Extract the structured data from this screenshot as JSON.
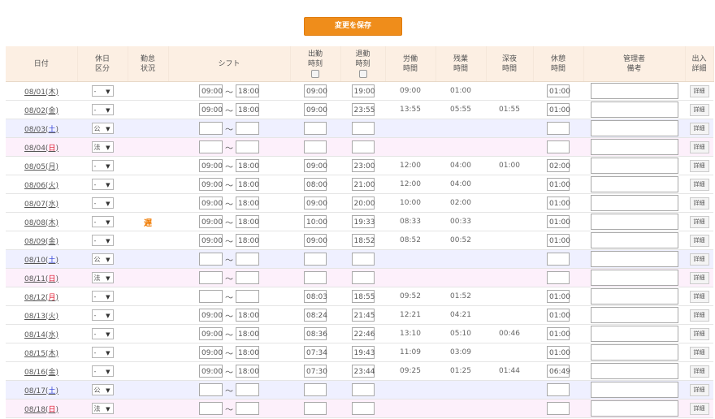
{
  "save_button": "変更を保存",
  "headers": {
    "date": "日付",
    "holiday1": "休日",
    "holiday2": "区分",
    "status1": "勤怠",
    "status2": "状況",
    "shift": "シフト",
    "in1": "出勤",
    "in2": "時刻",
    "out1": "退勤",
    "out2": "時刻",
    "work1": "労働",
    "work2": "時間",
    "over1": "残業",
    "over2": "時間",
    "night1": "深夜",
    "night2": "時間",
    "break1": "休憩",
    "break2": "時間",
    "memo1": "管理者",
    "memo2": "備考",
    "io1": "出入",
    "io2": "詳細"
  },
  "tilde": "～",
  "detail_label": "詳細",
  "rows": [
    {
      "date": "08/01(",
      "wd": "木",
      "wd_type": "weekday",
      "kubun": "-",
      "status": "",
      "shift_start": "09:00",
      "shift_end": "18:00",
      "in": "09:00",
      "out": "19:00",
      "work": "09:00",
      "over": "01:00",
      "night": "",
      "break": "01:00"
    },
    {
      "date": "08/02(",
      "wd": "金",
      "wd_type": "weekday",
      "kubun": "-",
      "status": "",
      "shift_start": "09:00",
      "shift_end": "18:00",
      "in": "09:00",
      "out": "23:55",
      "work": "13:55",
      "over": "05:55",
      "night": "01:55",
      "break": "01:00"
    },
    {
      "date": "08/03(",
      "wd": "土",
      "wd_type": "sat",
      "kubun": "公",
      "status": "",
      "shift_start": "",
      "shift_end": "",
      "in": "",
      "out": "",
      "work": "",
      "over": "",
      "night": "",
      "break": ""
    },
    {
      "date": "08/04(",
      "wd": "日",
      "wd_type": "sun",
      "kubun": "法",
      "status": "",
      "shift_start": "",
      "shift_end": "",
      "in": "",
      "out": "",
      "work": "",
      "over": "",
      "night": "",
      "break": ""
    },
    {
      "date": "08/05(",
      "wd": "月",
      "wd_type": "weekday",
      "kubun": "-",
      "status": "",
      "shift_start": "09:00",
      "shift_end": "18:00",
      "in": "09:00",
      "out": "23:00",
      "work": "12:00",
      "over": "04:00",
      "night": "01:00",
      "break": "02:00"
    },
    {
      "date": "08/06(",
      "wd": "火",
      "wd_type": "weekday",
      "kubun": "-",
      "status": "",
      "shift_start": "09:00",
      "shift_end": "18:00",
      "in": "08:00",
      "out": "21:00",
      "work": "12:00",
      "over": "04:00",
      "night": "",
      "break": "01:00"
    },
    {
      "date": "08/07(",
      "wd": "水",
      "wd_type": "weekday",
      "kubun": "-",
      "status": "",
      "shift_start": "09:00",
      "shift_end": "18:00",
      "in": "09:00",
      "out": "20:00",
      "work": "10:00",
      "over": "02:00",
      "night": "",
      "break": "01:00"
    },
    {
      "date": "08/08(",
      "wd": "木",
      "wd_type": "weekday",
      "kubun": "-",
      "status": "遅",
      "shift_start": "09:00",
      "shift_end": "18:00",
      "in": "10:00",
      "out": "19:33",
      "work": "08:33",
      "over": "00:33",
      "night": "",
      "break": "01:00"
    },
    {
      "date": "08/09(",
      "wd": "金",
      "wd_type": "weekday",
      "kubun": "-",
      "status": "",
      "shift_start": "09:00",
      "shift_end": "18:00",
      "in": "09:00",
      "out": "18:52",
      "work": "08:52",
      "over": "00:52",
      "night": "",
      "break": "01:00"
    },
    {
      "date": "08/10(",
      "wd": "土",
      "wd_type": "sat",
      "kubun": "公",
      "status": "",
      "shift_start": "",
      "shift_end": "",
      "in": "",
      "out": "",
      "work": "",
      "over": "",
      "night": "",
      "break": ""
    },
    {
      "date": "08/11(",
      "wd": "日",
      "wd_type": "sun",
      "kubun": "法",
      "status": "",
      "shift_start": "",
      "shift_end": "",
      "in": "",
      "out": "",
      "work": "",
      "over": "",
      "night": "",
      "break": ""
    },
    {
      "date": "08/12(",
      "wd": "月",
      "wd_type": "holiday",
      "kubun": "-",
      "status": "",
      "shift_start": "",
      "shift_end": "",
      "in": "08:03",
      "out": "18:55",
      "work": "09:52",
      "over": "01:52",
      "night": "",
      "break": "01:00"
    },
    {
      "date": "08/13(",
      "wd": "火",
      "wd_type": "weekday",
      "kubun": "-",
      "status": "",
      "shift_start": "09:00",
      "shift_end": "18:00",
      "in": "08:24",
      "out": "21:45",
      "work": "12:21",
      "over": "04:21",
      "night": "",
      "break": "01:00"
    },
    {
      "date": "08/14(",
      "wd": "水",
      "wd_type": "weekday",
      "kubun": "-",
      "status": "",
      "shift_start": "09:00",
      "shift_end": "18:00",
      "in": "08:36",
      "out": "22:46",
      "work": "13:10",
      "over": "05:10",
      "night": "00:46",
      "break": "01:00"
    },
    {
      "date": "08/15(",
      "wd": "木",
      "wd_type": "weekday",
      "kubun": "-",
      "status": "",
      "shift_start": "09:00",
      "shift_end": "18:00",
      "in": "07:34",
      "out": "19:43",
      "work": "11:09",
      "over": "03:09",
      "night": "",
      "break": "01:00"
    },
    {
      "date": "08/16(",
      "wd": "金",
      "wd_type": "weekday",
      "kubun": "-",
      "status": "",
      "shift_start": "09:00",
      "shift_end": "18:00",
      "in": "07:30",
      "out": "23:44",
      "work": "09:25",
      "over": "01:25",
      "night": "01:44",
      "break": "06:49"
    },
    {
      "date": "08/17(",
      "wd": "土",
      "wd_type": "sat",
      "kubun": "公",
      "status": "",
      "shift_start": "",
      "shift_end": "",
      "in": "",
      "out": "",
      "work": "",
      "over": "",
      "night": "",
      "break": ""
    },
    {
      "date": "08/18(",
      "wd": "日",
      "wd_type": "sun",
      "kubun": "法",
      "status": "",
      "shift_start": "",
      "shift_end": "",
      "in": "",
      "out": "",
      "work": "",
      "over": "",
      "night": "",
      "break": ""
    }
  ]
}
